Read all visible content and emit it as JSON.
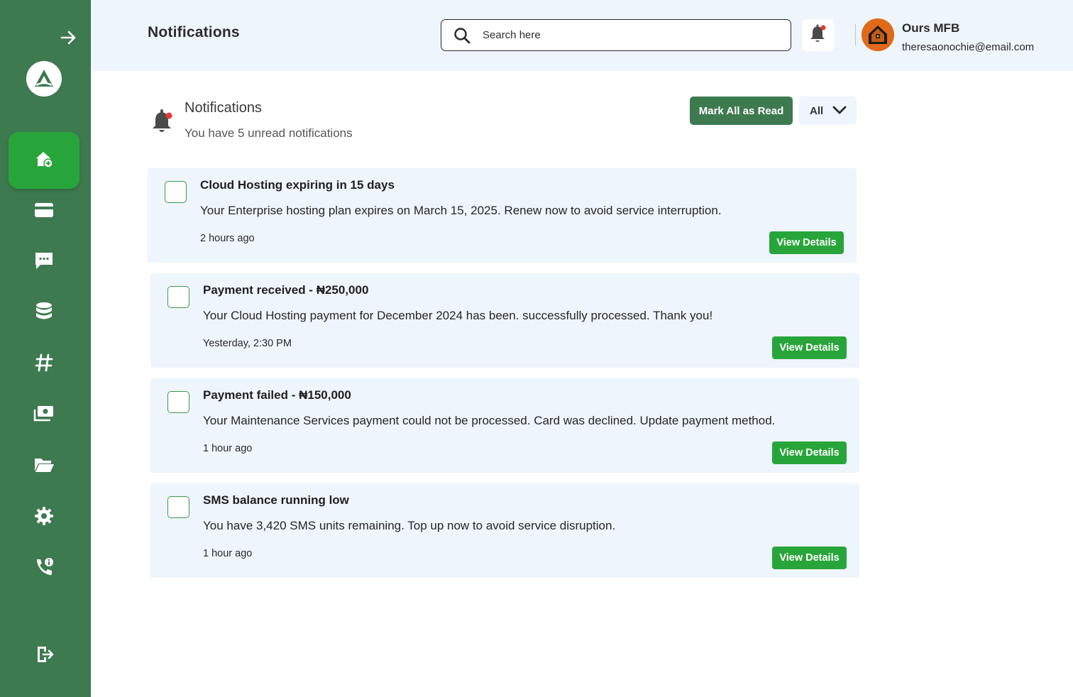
{
  "sidebar": {
    "collapse_icon": "arrow-right-icon",
    "logo_icon": "brand-logo-icon",
    "items": [
      {
        "name": "home",
        "icon": "home-plus-icon",
        "active": true
      },
      {
        "name": "billing",
        "icon": "credit-card-icon",
        "active": false
      },
      {
        "name": "messages",
        "icon": "chat-icon",
        "active": false
      },
      {
        "name": "database",
        "icon": "database-icon",
        "active": false
      },
      {
        "name": "hashtag",
        "icon": "hashtag-icon",
        "active": false
      },
      {
        "name": "payments",
        "icon": "money-icon",
        "active": false
      },
      {
        "name": "files",
        "icon": "folder-open-icon",
        "active": false
      },
      {
        "name": "settings",
        "icon": "gear-icon",
        "active": false
      },
      {
        "name": "support",
        "icon": "phone-info-icon",
        "active": false
      }
    ],
    "logout_icon": "logout-icon"
  },
  "header": {
    "title": "Notifications",
    "search_placeholder": "Search here",
    "user_name": "Ours MFB",
    "user_email": "theresaonochie@email.com"
  },
  "section": {
    "title": "Notifications",
    "subtitle": "You have 5 unread notifications",
    "mark_all_label": "Mark All as Read",
    "filter_value": "All"
  },
  "notifications": [
    {
      "title": "Cloud Hosting expiring in 15 days",
      "body": "Your Enterprise hosting plan expires on March 15, 2025. Renew now to avoid service interruption.",
      "time": "2 hours ago",
      "action": "View Details"
    },
    {
      "title": "Payment received - ₦250,000",
      "body": "Your Cloud Hosting payment for December 2024 has been. successfully processed. Thank you!",
      "time": "Yesterday, 2:30 PM",
      "action": "View Details"
    },
    {
      "title": "Payment failed - ₦150,000",
      "body": "Your Maintenance Services payment could not be processed. Card was declined. Update payment method.",
      "time": "1 hour ago",
      "action": "View Details"
    },
    {
      "title": "SMS balance running low",
      "body": "You have 3,420 SMS units remaining. Top up now to avoid service disruption.",
      "time": "1 hour ago",
      "action": "View Details"
    }
  ],
  "colors": {
    "sidebar": "#3d7a4f",
    "accent": "#28a53a",
    "header_bg": "#eef5fd",
    "unread_dot": "#e53935"
  }
}
